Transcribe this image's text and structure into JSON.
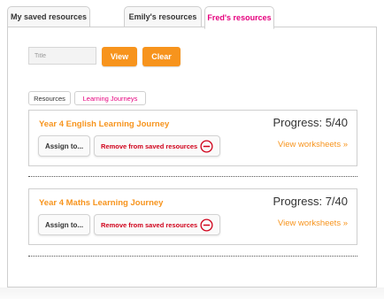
{
  "tabs": {
    "mine": "My saved resources",
    "emily": "Emily's resources",
    "fred": "Fred's resources"
  },
  "filter": {
    "title_placeholder": "Title",
    "view_label": "View",
    "clear_label": "Clear"
  },
  "types": {
    "resources": "Resources",
    "learning_journeys": "Learning Journeys"
  },
  "items": [
    {
      "title": "Year 4 English Learning Journey",
      "progress": "Progress: 5/40",
      "assign_label": "Assign to...",
      "remove_label": "Remove from saved resources",
      "view_label": "View worksheets  »"
    },
    {
      "title": "Year 4 Maths Learning Journey",
      "progress": "Progress: 7/40",
      "assign_label": "Assign to...",
      "remove_label": "Remove from saved resources",
      "view_label": "View worksheets  »"
    }
  ],
  "colors": {
    "accent_orange": "#f7941d",
    "active_tab_pink": "#e6007e",
    "remove_red": "#d0021b"
  },
  "icons": {
    "remove": "minus-circle-icon"
  }
}
